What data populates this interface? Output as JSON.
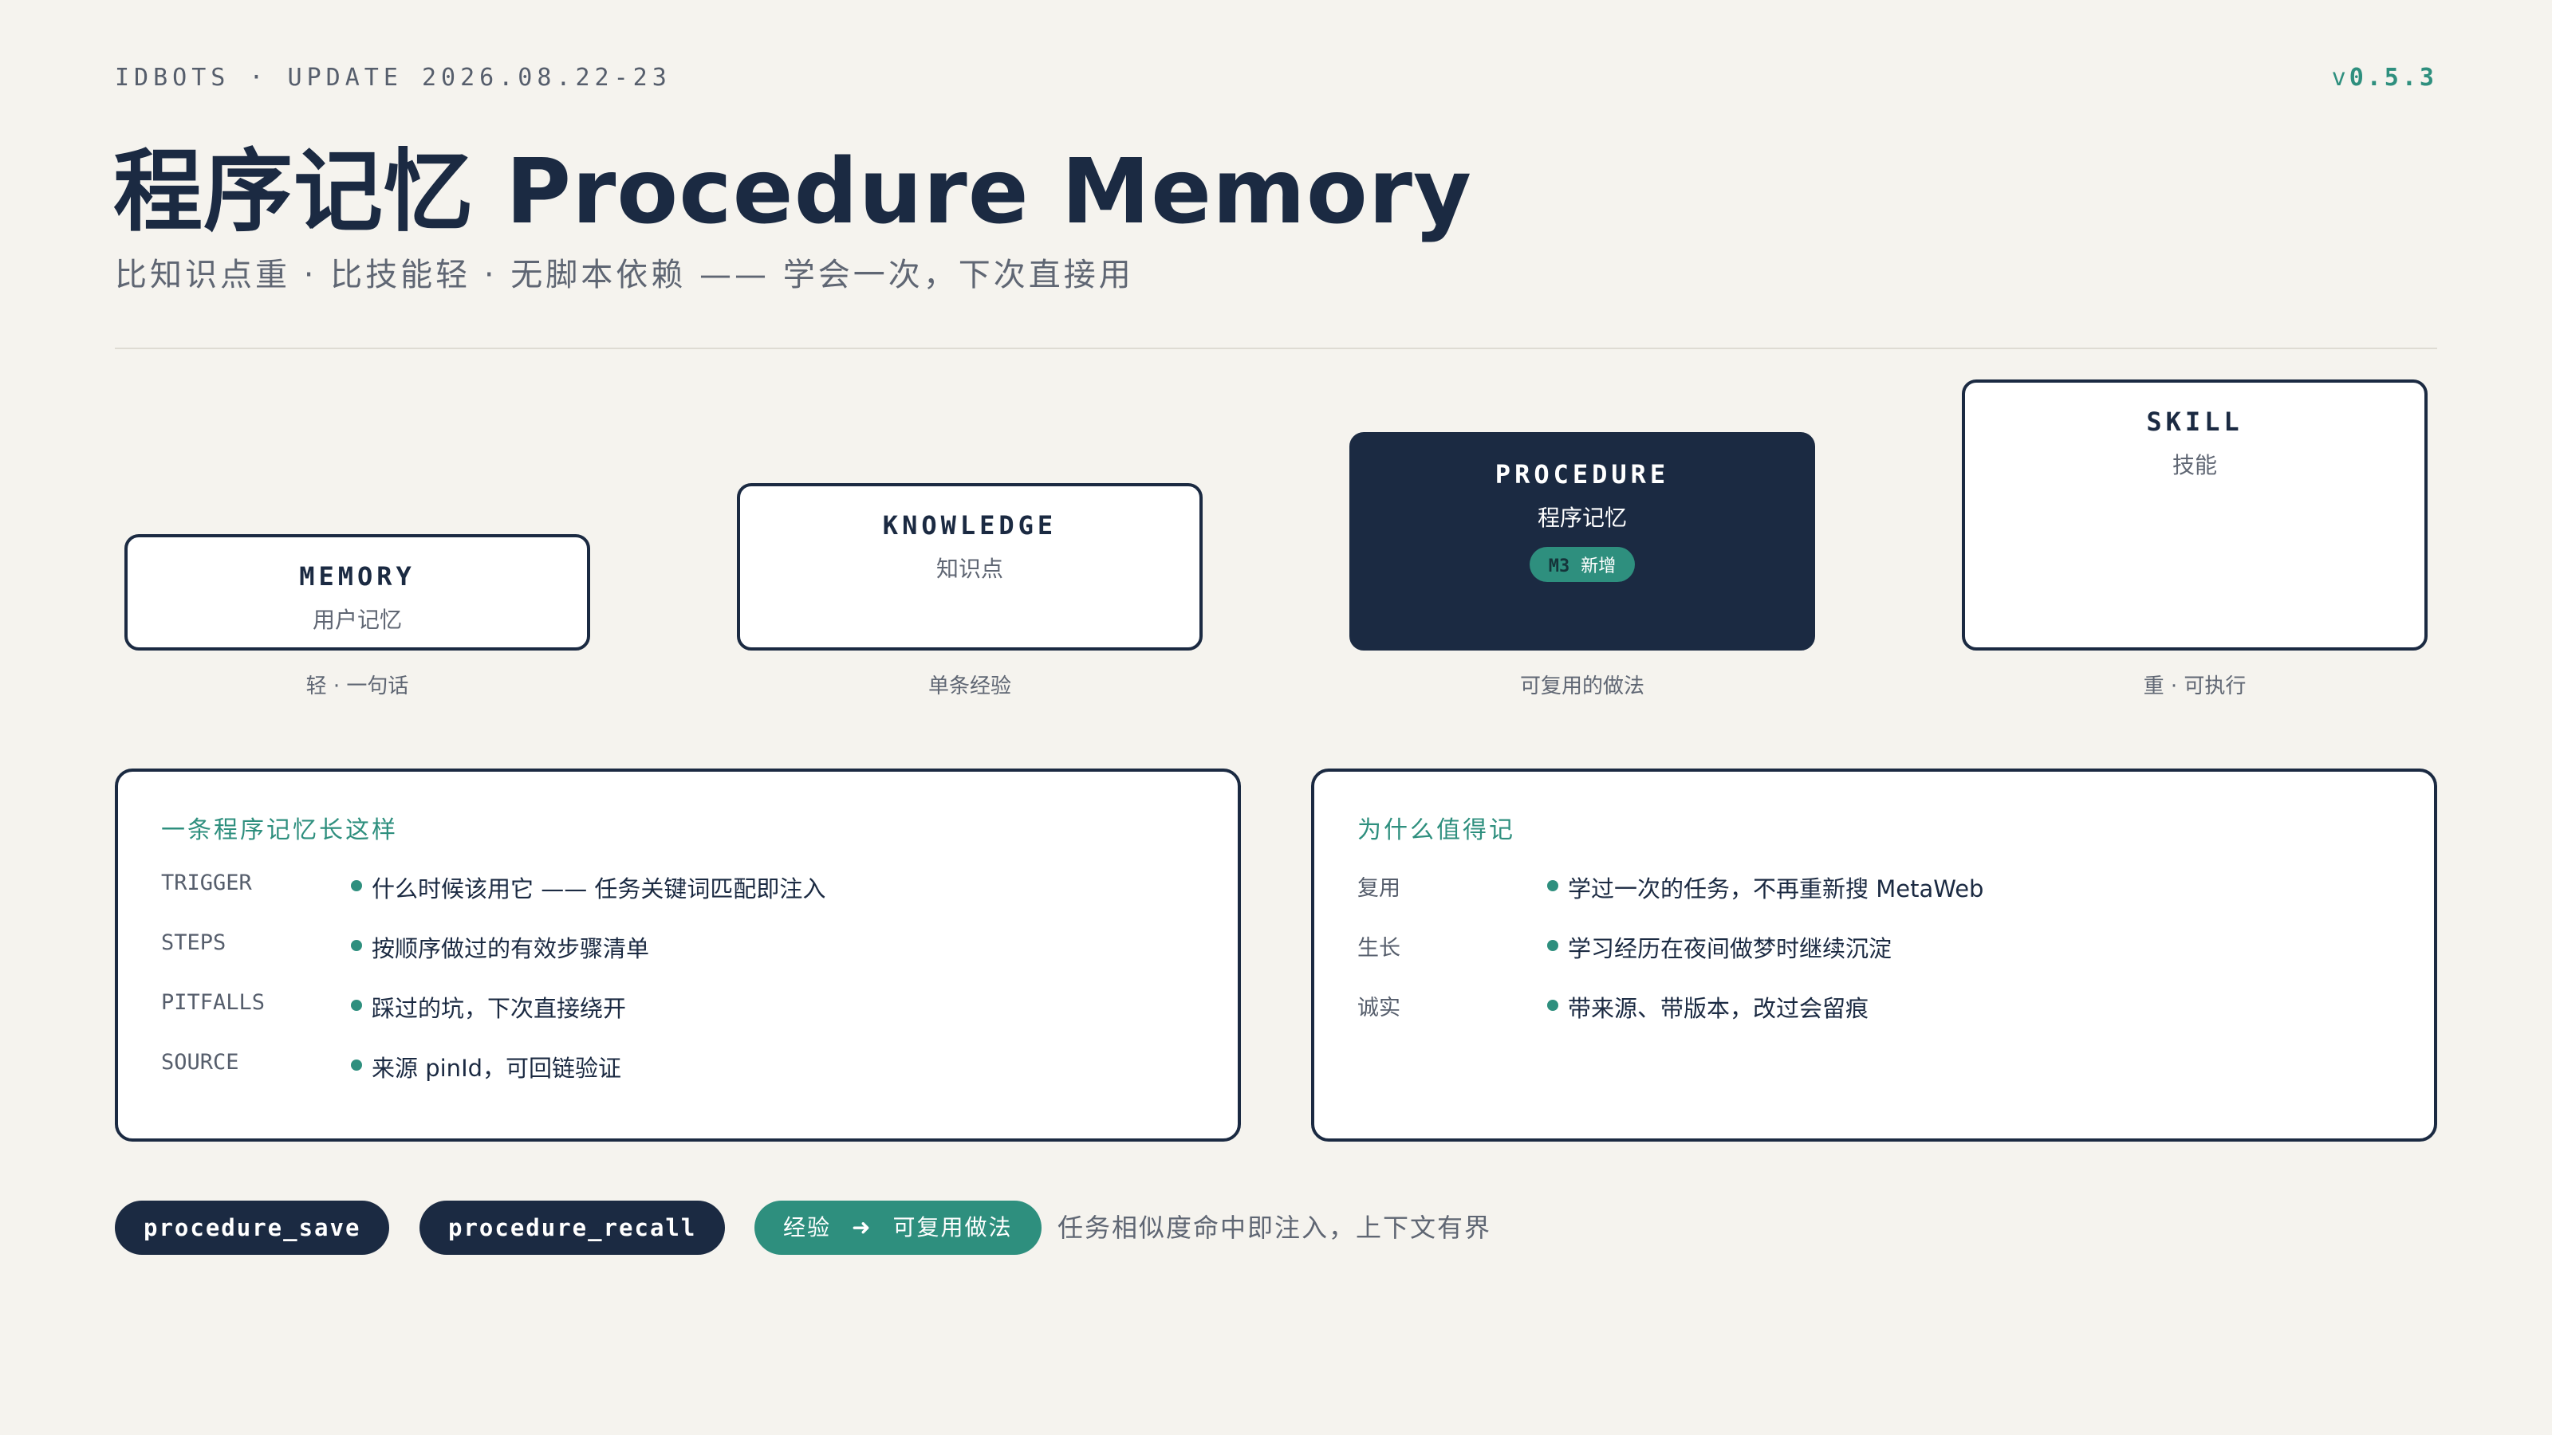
{
  "header": {
    "topline": "IDBOTS · UPDATE 2026.08.22-23",
    "version_prefix": "v",
    "version_number": "0.5.3",
    "title": "程序记忆 Procedure Memory",
    "subtitle": "比知识点重 · 比技能轻 · 无脚本依赖 —— 学会一次，下次直接用"
  },
  "levels": [
    {
      "name": "MEMORY",
      "sub": "用户记忆",
      "caption": "轻 · 一句话"
    },
    {
      "name": "KNOWLEDGE",
      "sub": "知识点",
      "caption": "单条经验"
    },
    {
      "name": "PROCEDURE",
      "sub": "程序记忆",
      "badge_code": "M3",
      "badge_text": "新增",
      "caption": "可复用的做法",
      "highlighted": true
    },
    {
      "name": "SKILL",
      "sub": "技能",
      "caption": "重 · 可执行"
    }
  ],
  "anatomy": {
    "title": "一条程序记忆长这样",
    "rows": [
      {
        "key": "TRIGGER",
        "value": "什么时候该用它 —— 任务关键词匹配即注入"
      },
      {
        "key": "STEPS",
        "value": "按顺序做过的有效步骤清单"
      },
      {
        "key": "PITFALLS",
        "value": "踩过的坑，下次直接绕开"
      },
      {
        "key": "SOURCE",
        "value": "来源 pinId，可回链验证"
      }
    ]
  },
  "reasons": {
    "title": "为什么值得记",
    "rows": [
      {
        "key": "复用",
        "value": "学过一次的任务，不再重新搜 MetaWeb"
      },
      {
        "key": "生长",
        "value": "学习经历在夜间做梦时继续沉淀"
      },
      {
        "key": "诚实",
        "value": "带来源、带版本，改过会留痕"
      }
    ]
  },
  "footer": {
    "tool_save": "procedure_save",
    "tool_recall": "procedure_recall",
    "flow_from": "经验",
    "flow_arrow": "➜",
    "flow_to": "可复用做法",
    "note": "任务相似度命中即注入，上下文有界"
  },
  "colors": {
    "background": "#f5f3ee",
    "navy": "#1b2a42",
    "accent": "#2e8f7e",
    "muted": "#5f6673"
  }
}
